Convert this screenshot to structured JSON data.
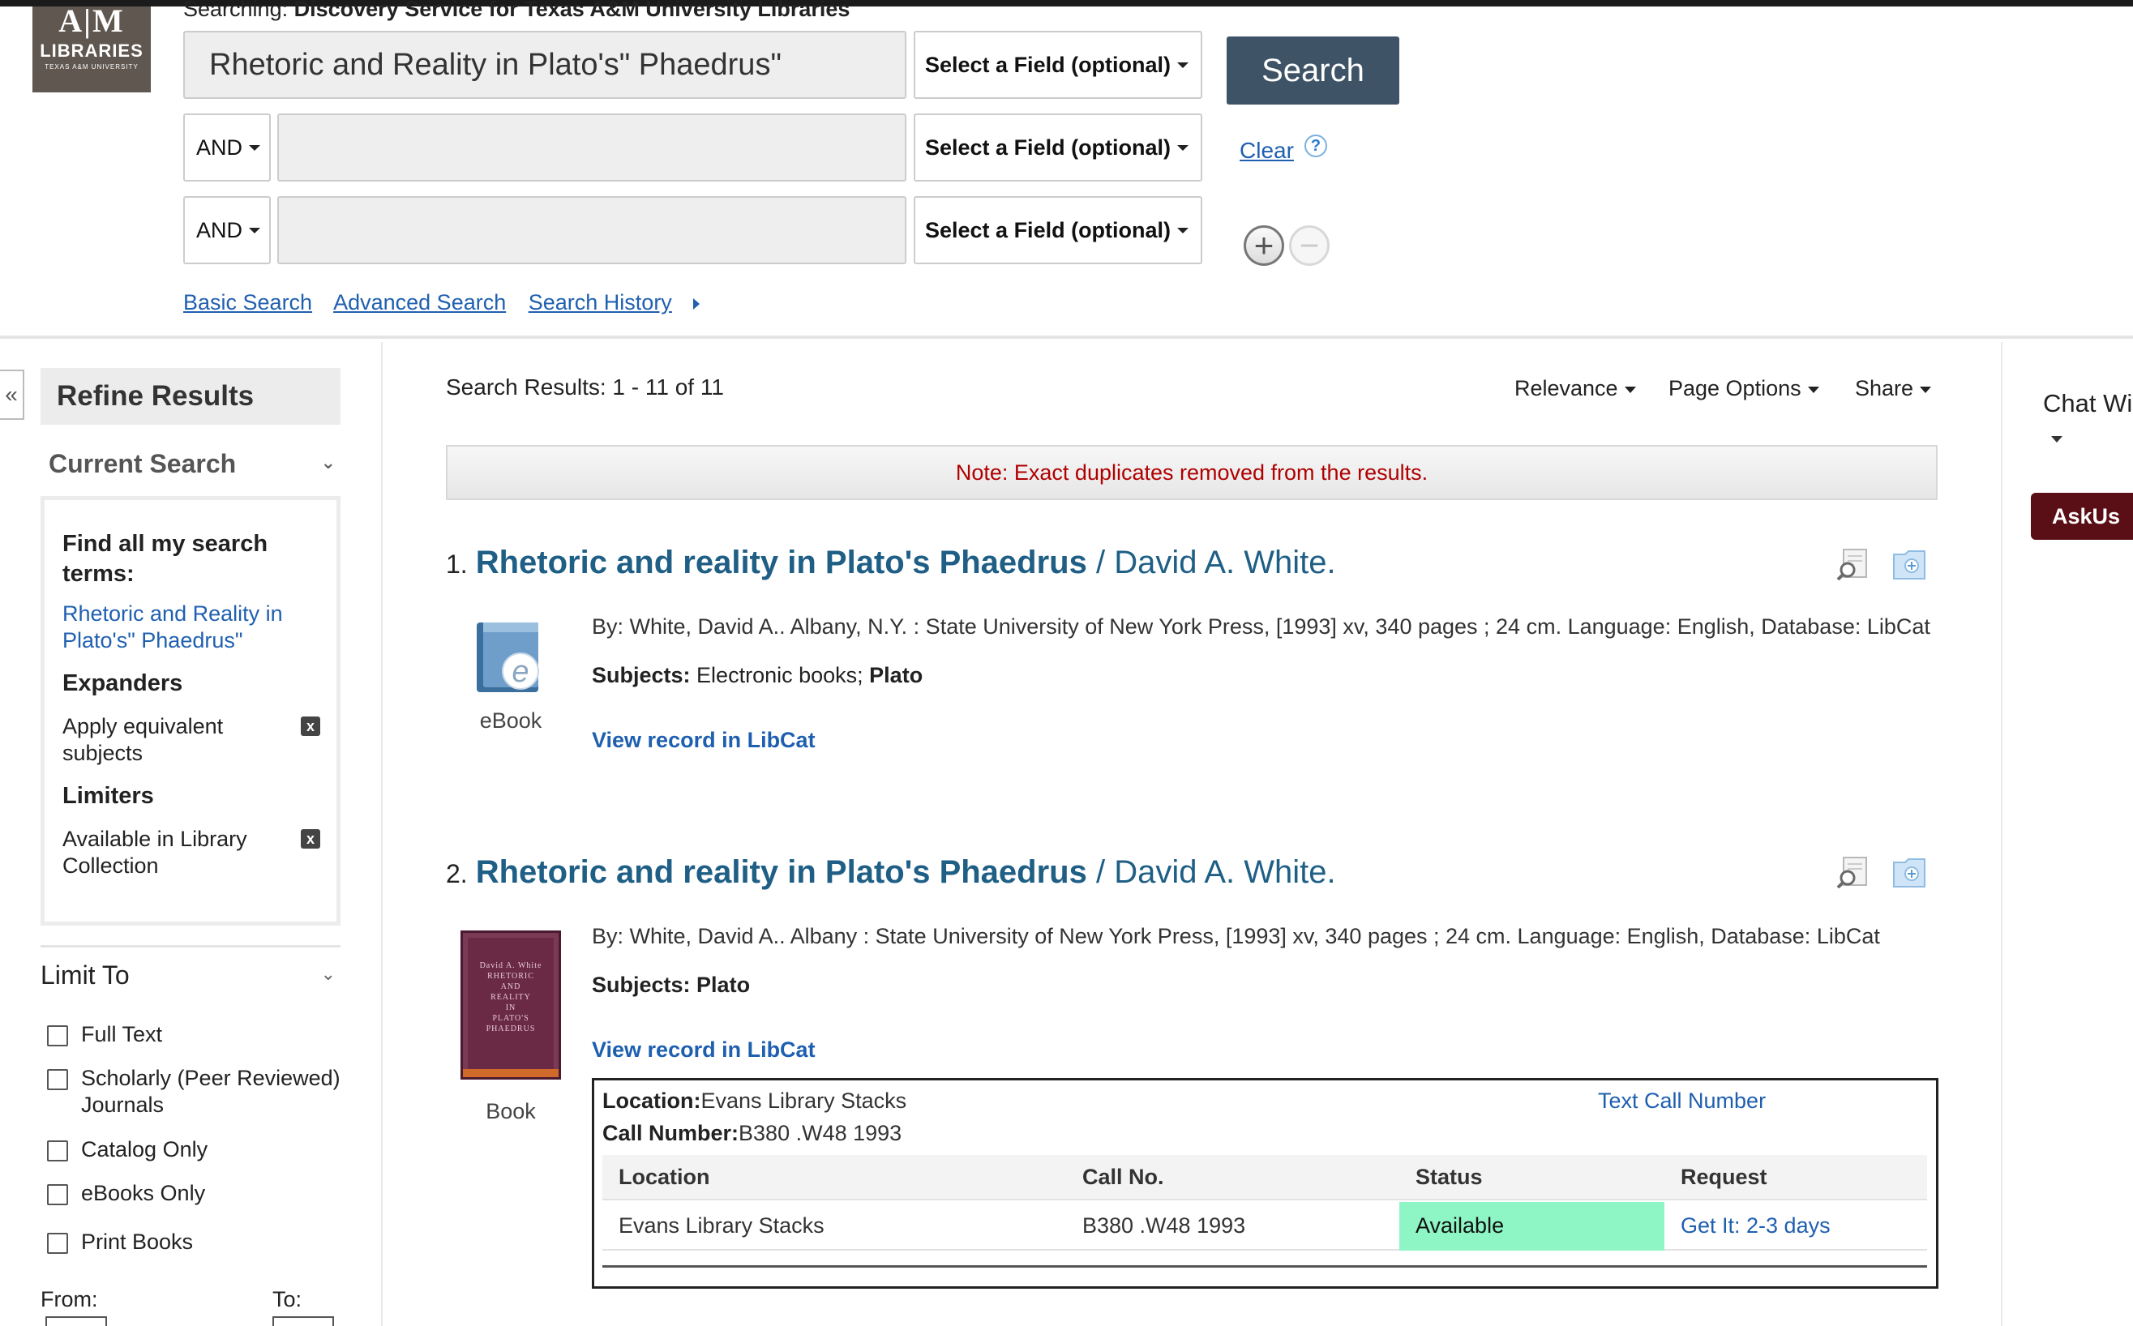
{
  "colors": {
    "search_button": "#3e5366",
    "link": "#2060b0",
    "title": "#1f5f86",
    "note_text": "#b00000",
    "available_bg": "#8ef5c4",
    "askus_bg": "#5a0f16"
  },
  "logo": {
    "mark": "A|M",
    "word": "LIBRARIES",
    "sub": "TEXAS A&M UNIVERSITY"
  },
  "header": {
    "searching_label": "Searching:",
    "searching_service": "Discovery Service for Texas A&M University Libraries"
  },
  "search": {
    "rows": [
      {
        "bool": "",
        "value": "Rhetoric and Reality in Plato's\" Phaedrus\"",
        "field": "Select a Field (optional)"
      },
      {
        "bool": "AND",
        "value": "",
        "field": "Select a Field (optional)"
      },
      {
        "bool": "AND",
        "value": "",
        "field": "Select a Field (optional)"
      }
    ],
    "search_button": "Search",
    "clear": "Clear",
    "help_icon": "?",
    "add_row_icon": "+",
    "remove_row_icon": "−",
    "links": {
      "basic": "Basic Search",
      "advanced": "Advanced Search",
      "history": "Search History"
    }
  },
  "sidebar": {
    "collapse_icon": "«",
    "refine_title": "Refine Results",
    "current_search_title": "Current Search",
    "find_all_heading": "Find all my search terms:",
    "find_all_terms": "Rhetoric and Reality in Plato's\" Phaedrus\"",
    "expanders_heading": "Expanders",
    "expanders": [
      "Apply equivalent subjects"
    ],
    "limiters_heading": "Limiters",
    "limiters": [
      "Available in Library Collection"
    ],
    "remove_icon": "x",
    "limit_to_title": "Limit To",
    "limit_options": [
      "Full Text",
      "Scholarly (Peer Reviewed) Journals",
      "Catalog Only",
      "eBooks Only",
      "Print Books"
    ],
    "from_label": "From:",
    "to_label": "To:"
  },
  "results": {
    "count_text": "Search Results: 1 - 11 of 11",
    "sort": "Relevance",
    "page_options": "Page Options",
    "share": "Share",
    "note": "Note: Exact duplicates removed from the results.",
    "items": [
      {
        "number": "1.",
        "title": "Rhetoric and reality in Plato's Phaedrus",
        "author": " / David A. White.",
        "meta": "By: White, David A.. Albany, N.Y. : State University of New York Press, [1993] xv, 340 pages ; 24 cm. Language: English, Database: LibCat",
        "subjects_label": "Subjects:",
        "subjects": "Electronic books;",
        "subjects_bold": "Plato",
        "view_link": "View record in LibCat",
        "type": "eBook"
      },
      {
        "number": "2.",
        "title": "Rhetoric and reality in Plato's Phaedrus",
        "author": " / David A. White.",
        "meta": "By: White, David A.. Albany : State University of New York Press, [1993] xv, 340 pages ; 24 cm. Language: English, Database: LibCat",
        "subjects_label": "Subjects:",
        "subjects": "",
        "subjects_bold": "Plato",
        "view_link": "View record in LibCat",
        "type": "Book",
        "cover_lines": [
          "David A. White",
          "RHETORIC",
          "AND",
          "REALITY",
          "IN",
          "PLATO'S",
          "PHAEDRUS"
        ]
      }
    ],
    "holdings": {
      "location_label": "Location:",
      "location": "Evans Library Stacks",
      "callnumber_label": "Call Number:",
      "callnumber": "B380 .W48 1993",
      "text_call_number": "Text Call Number",
      "headers": [
        "Location",
        "Call No.",
        "Status",
        "Request"
      ],
      "row": {
        "location": "Evans Library Stacks",
        "call_no": "B380 .W48 1993",
        "status": "Available",
        "request": "Get It: 2-3 days"
      }
    }
  },
  "rightcol": {
    "chat": "Chat Wi",
    "askus": "AskUs"
  }
}
